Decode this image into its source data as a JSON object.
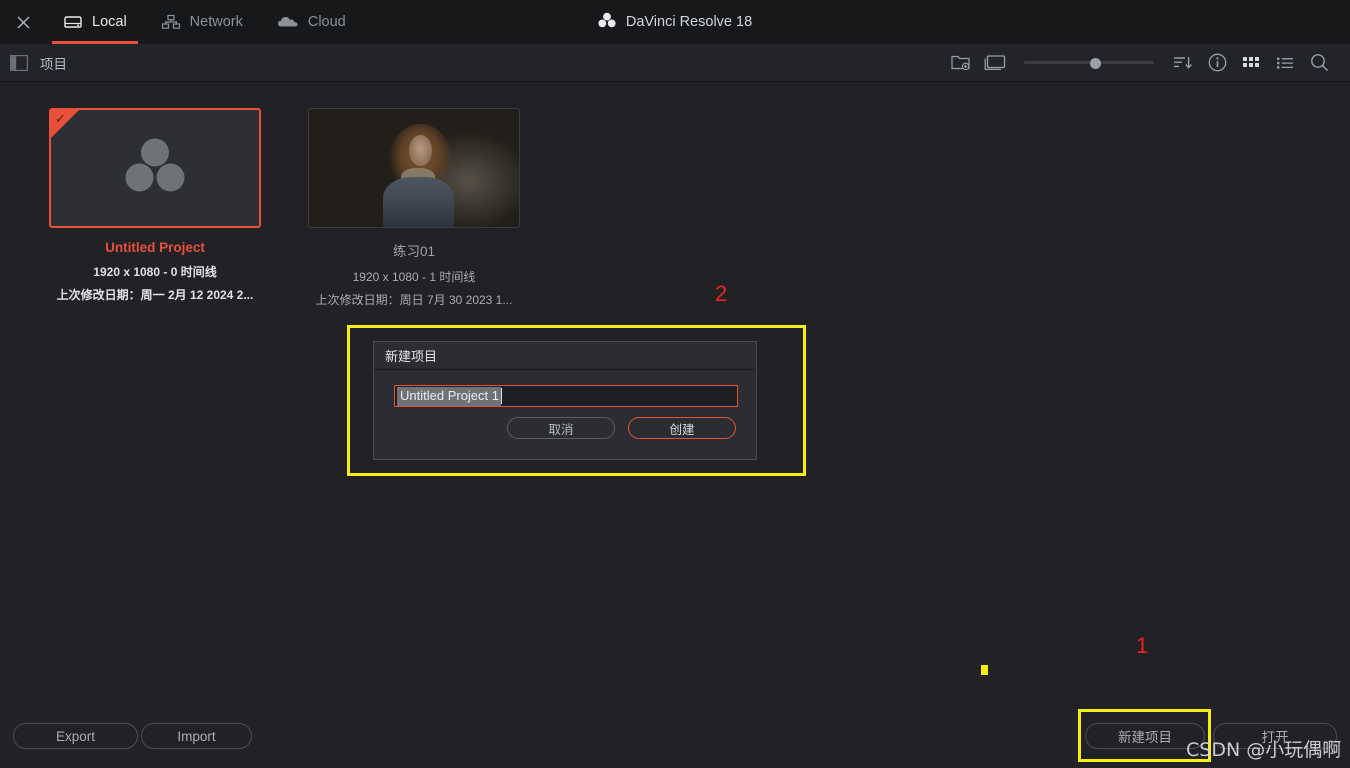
{
  "window": {
    "app_title": "DaVinci Resolve 18",
    "close_icon": "close-icon",
    "logo_icon": "resolve-logo-icon"
  },
  "tabs": [
    {
      "label": "Local",
      "icon": "drive-icon",
      "active": true
    },
    {
      "label": "Network",
      "icon": "network-icon",
      "active": false
    },
    {
      "label": "Cloud",
      "icon": "cloud-icon",
      "active": false
    }
  ],
  "toolbar": {
    "panel_toggle_icon": "sidebar-toggle-icon",
    "label": "项目",
    "icons": [
      "new-folder-icon",
      "display-icon",
      "zoom-slider",
      "sort-icon",
      "info-icon",
      "grid-view-icon",
      "list-view-icon",
      "search-icon"
    ],
    "zoom_value": 50
  },
  "projects": [
    {
      "name": "Untitled Project",
      "resolution": "1920 x 1080 - 0 时间线",
      "modified": "上次修改日期：周一 2月 12 2024 2...",
      "selected": true,
      "thumb": "resolve-logo-placeholder",
      "badge": "checkmark"
    },
    {
      "name": "练习01",
      "resolution": "1920 x 1080 - 1 时间线",
      "modified": "上次修改日期：周日 7月 30 2023 1...",
      "selected": false,
      "thumb": "portrait-photo",
      "badge": ""
    }
  ],
  "dialog": {
    "title": "新建项目",
    "input_value": "Untitled Project 1",
    "input_placeholder": "Untitled Project 1",
    "cancel_label": "取消",
    "create_label": "创建"
  },
  "footer": {
    "export_label": "Export",
    "import_label": "Import",
    "new_project_label": "新建项目",
    "open_label": "打开"
  },
  "annotations": {
    "marker_one": "1",
    "marker_two": "2"
  },
  "watermark": {
    "text": "CSDN @小玩偶啊"
  },
  "colors": {
    "accent_red": "#e8503a",
    "annotation_red": "#e8261e",
    "highlight_yellow": "#f5ef10",
    "window_bg": "#212126",
    "titlebar_bg": "#17181a",
    "toolbar_bg": "#232429"
  }
}
